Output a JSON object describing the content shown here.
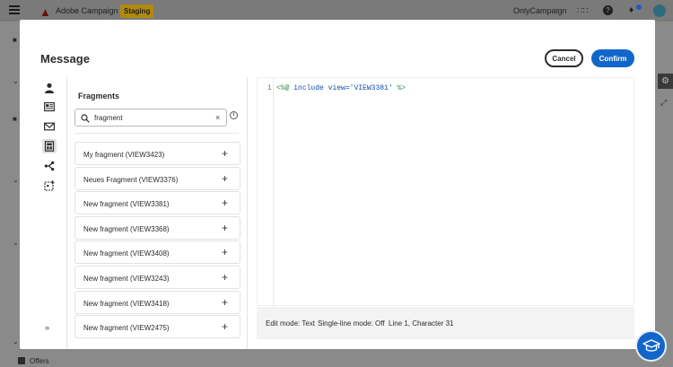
{
  "app": {
    "name": "Adobe Campaign",
    "environment_badge": "Staging",
    "org_name": "OnlyCampaign",
    "help_glyph": "?",
    "background_nav_item": "Offers"
  },
  "modal": {
    "title": "Message",
    "cancel_label": "Cancel",
    "confirm_label": "Confirm",
    "rail_expand_glyph": "»",
    "rail_icons": [
      "person-icon",
      "newspaper-icon",
      "envelope-icon",
      "fragment-icon",
      "branch-icon",
      "calendar-add-icon"
    ],
    "active_rail_icon": "fragment-icon"
  },
  "fragments": {
    "title": "Fragments",
    "search_value": "fragment",
    "clear_glyph": "×",
    "info_glyph": "i",
    "add_glyph": "+",
    "items": [
      "My fragment (VIEW3423)",
      "Neues Fragment (VIEW3376)",
      "New fragment (VIEW3381)",
      "New fragment (VIEW3368)",
      "New fragment (VIEW3408)",
      "New fragment (VIEW3243)",
      "New fragment (VIEW3418)",
      "New fragment (VIEW2475)"
    ]
  },
  "editor": {
    "line_number": "1",
    "code": {
      "open": "<%@",
      "directive": "include",
      "attr": "view=",
      "value": "'VIEW3381'",
      "close": "%>"
    },
    "status": {
      "edit_mode": "Edit mode: Text",
      "single_line": "Single-line mode: Off",
      "position": "Line 1, Character 31"
    }
  },
  "colors": {
    "accent": "#1366c9",
    "code_delimiter": "#2f8f4e",
    "code_keyword": "#0f4ea8"
  }
}
